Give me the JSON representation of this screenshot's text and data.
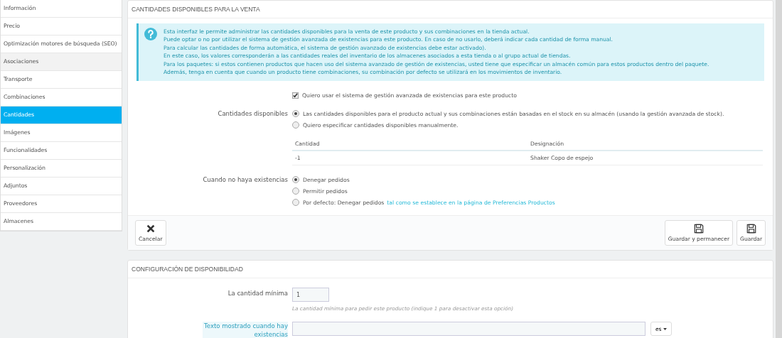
{
  "sidebar": {
    "items": [
      {
        "label": "Información",
        "selected": false
      },
      {
        "label": "Precio",
        "selected": false
      },
      {
        "label": "Optimización motores de búsqueda (SEO)",
        "selected": false
      },
      {
        "label": "Asociaciones",
        "selected": false,
        "hovered": true
      },
      {
        "label": "Transporte",
        "selected": false
      },
      {
        "label": "Combinaciones",
        "selected": false
      },
      {
        "label": "Cantidades",
        "selected": true
      },
      {
        "label": "Imágenes",
        "selected": false
      },
      {
        "label": "Funcionalidades",
        "selected": false
      },
      {
        "label": "Personalización",
        "selected": false
      },
      {
        "label": "Adjuntos",
        "selected": false
      },
      {
        "label": "Proveedores",
        "selected": false
      },
      {
        "label": "Almacenes",
        "selected": false
      }
    ]
  },
  "quantities_panel": {
    "title": "CANTIDADES DISPONIBLES PARA LA VENTA",
    "info_lines": [
      "Esta interfaz le permite administrar las cantidades disponibles para la venta de este producto y sus combinaciones en la tienda actual.",
      "Puede optar o no por utilizar el sistema de gestión avanzada de existencias para este producto. En caso de no usarlo, deberá indicar cada cantidad de forma manual.",
      "Para calcular las cantidades de forma automática, el sistema de gestión avanzado de existencias debe estar activado).",
      "En este caso, los valores corresponderán a las cantidades reales del inventario de los almacenes asociados a esta tienda o al grupo actual de tiendas.",
      "Para los paquetes: si estos contienen productos que hacen uso del sistema avanzado de gestión de existencias, usted tiene que especificar un almacén común para estos productos dentro del paquete.",
      "Además, tenga en cuenta que cuando un producto tiene combinaciones, su combinación por defecto se utilizará en los movimientos de inventario."
    ],
    "advanced_stock": {
      "label": "Quiero usar el sistema de gestión avanzada de existencias para este producto",
      "checked": true
    },
    "available": {
      "label": "Cantidades disponibles",
      "options": [
        {
          "label": "Las cantidades disponibles para el producto actual y sus combinaciones están basadas en el stock en su almacén (usando la gestión avanzada de stock).",
          "selected": true
        },
        {
          "label": "Quiero especificar cantidades disponibles manualmente.",
          "selected": false
        }
      ]
    },
    "table": {
      "columns": [
        "Cantidad",
        "Designación"
      ],
      "rows": [
        [
          "-1",
          "Shaker Copo de espejo"
        ]
      ]
    },
    "out_of_stock": {
      "label": "Cuando no haya existencias",
      "options": [
        {
          "label": "Denegar pedidos",
          "selected": true
        },
        {
          "label": "Permitir pedidos",
          "selected": false
        },
        {
          "label": "Por defecto: Denegar pedidos",
          "link": "tal como se establece en la página de Preferencias Productos",
          "selected": false
        }
      ]
    },
    "buttons": [
      {
        "label": "Cancelar",
        "kind": "cancel"
      },
      {
        "label": "Guardar y permanecer",
        "kind": "save"
      },
      {
        "label": "Guardar",
        "kind": "save"
      }
    ]
  },
  "availability_panel": {
    "title": "CONFIGURACIÓN DE DISPONIBILIDAD",
    "min_quantity": {
      "label": "La cantidad mínima",
      "value": "1",
      "hint": "La cantidad mínima para pedir este producto (indique 1 para desactivar esta opción)"
    },
    "in_stock_text": {
      "label": "Texto mostrado cuando hay existencias",
      "language": "es"
    }
  }
}
